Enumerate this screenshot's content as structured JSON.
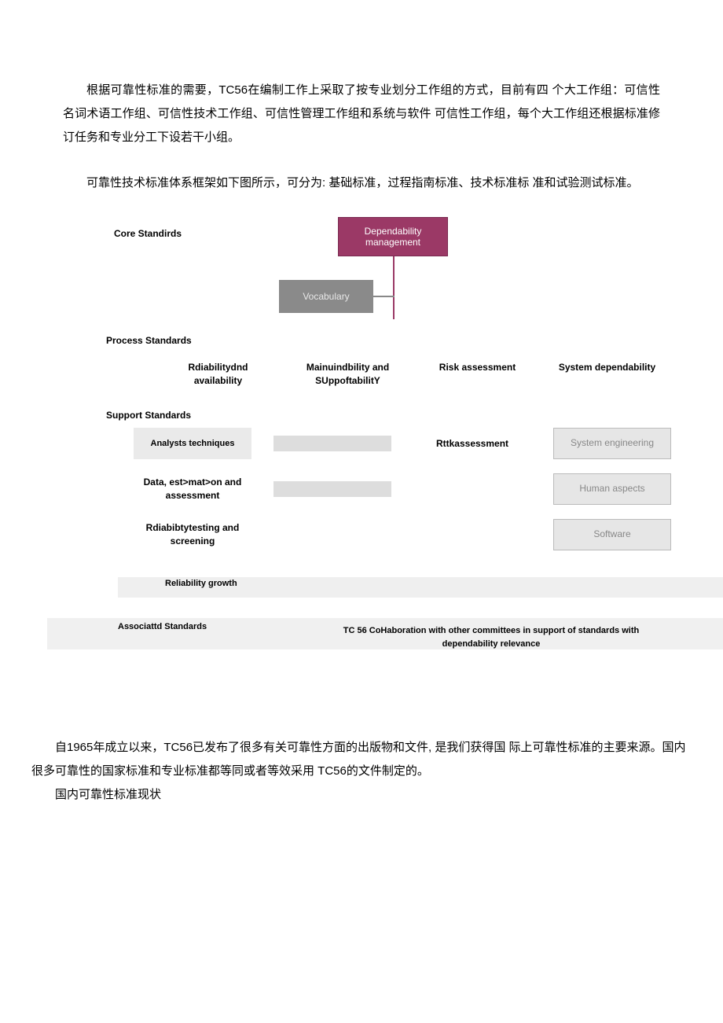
{
  "paragraphs": {
    "p1": "根据可靠性标准的需要，TC56在编制工作上采取了按专业划分工作组的方式，目前有四   个大工作组：可信性名词术语工作组、可信性技术工作组、可信性管理工作组和系统与软件     可信性工作组，每个大工作组还根据标准修订任务和专业分工下设若干小组。",
    "p2": "可靠性技术标准体系框架如下图所示，可分为: 基础标准，过程指南标准、技术标准标     准和试验测试标准。",
    "p3a": "自1965年成立以来，TC56已发布了很多有关可靠性方面的出版物和文件,  是我们获得国 际上可靠性标准的主要来源。国内很多可靠性的国家标准和专业标准都等同或者等效采用 TC56的文件制定的。",
    "p4": "国内可靠性标准现状"
  },
  "diagram": {
    "core_label": "Core Standirds",
    "dep_mgmt": "Dependability management",
    "vocab": "Vocabulary",
    "process_label": "Process Standards",
    "process_cols": {
      "c1": "Rdiabilitydnd availability",
      "c2": "Mainuindbility and SUppoftabilitY",
      "c3": "Risk assessment",
      "c4": "System dependability"
    },
    "support_label": "Support Standards",
    "support": {
      "r1c1": "Analysts techniques",
      "r1c3": "Rttkassessment",
      "r1c4": "System engineering",
      "r2c1": "Data, est>mat>on and assessment",
      "r2c4": "Human aspects",
      "r3c1": "Rdiabibtytesting and screening",
      "r3c4": "Software"
    },
    "rel_growth": "Reliability growth",
    "assoc_label": "Associattd Standards",
    "assoc_text": "TC 56 CoHaboration with other committees in support of standards with dependability relevance"
  }
}
